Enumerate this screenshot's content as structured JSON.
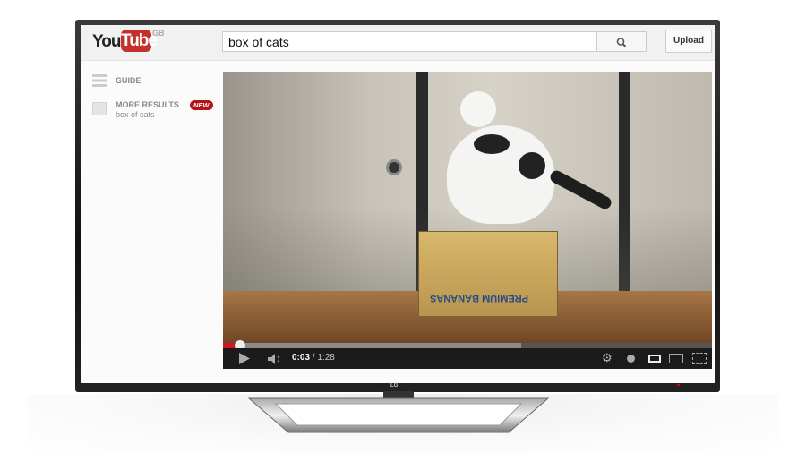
{
  "header": {
    "logo_text_left": "You",
    "logo_text_right": "Tube",
    "region": "GB",
    "search_value": "box of cats",
    "search_icon": "magnifier-icon",
    "upload_label": "Upload"
  },
  "sidebar": {
    "items": [
      {
        "label": "GUIDE",
        "icon": "hamburger-icon"
      },
      {
        "label": "MORE RESULTS",
        "sublabel": "box of cats",
        "badge": "NEW",
        "icon": "ellipsis-icon"
      }
    ]
  },
  "video": {
    "box_text": "PREMIUM BANANAS",
    "current_time": "0:03",
    "duration": "1:28",
    "played_percent": 0.035,
    "buffered_percent": 0.61
  },
  "tv": {
    "brand": "LG"
  },
  "colors": {
    "youtube_red": "#c4302b",
    "progress_red": "#cc181e",
    "badge_red": "#b31217"
  }
}
